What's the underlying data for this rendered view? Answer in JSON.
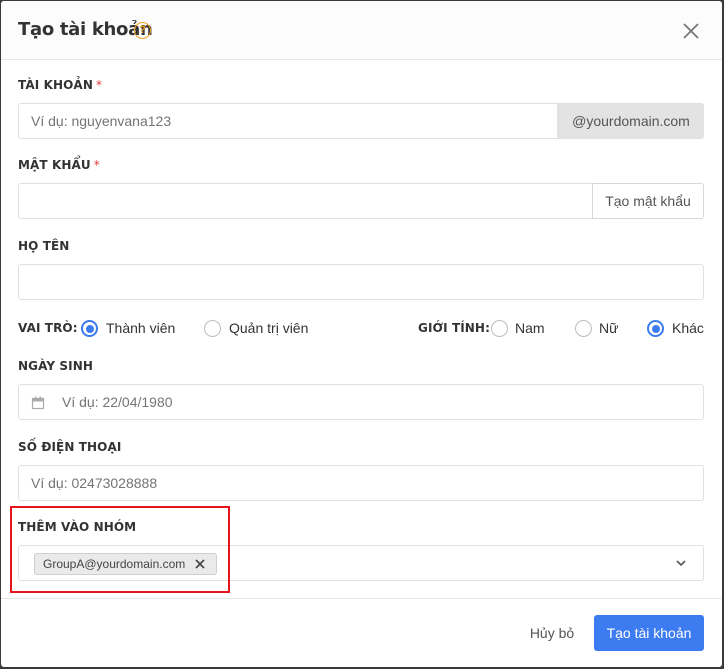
{
  "dialog": {
    "title": "Tạo tài khoản",
    "help_icon": "help-circle-icon",
    "close_icon": "close-icon"
  },
  "account": {
    "label": "TÀI KHOẢN",
    "required_mark": "*",
    "placeholder": "Ví dụ: nguyenvana123",
    "value": "",
    "domain_suffix": "@yourdomain.com"
  },
  "password": {
    "label": "MẬT KHẨU",
    "required_mark": "*",
    "value": "",
    "generate_button": "Tạo mật khẩu"
  },
  "fullname": {
    "label": "HỌ TÊN",
    "value": ""
  },
  "role": {
    "label": "VAI TRÒ:",
    "options": [
      {
        "label": "Thành viên",
        "selected": true
      },
      {
        "label": "Quản trị viên",
        "selected": false
      }
    ]
  },
  "gender": {
    "label": "GIỚI TÍNH:",
    "options": [
      {
        "label": "Nam",
        "selected": false
      },
      {
        "label": "Nữ",
        "selected": false
      },
      {
        "label": "Khác",
        "selected": true
      }
    ]
  },
  "birthday": {
    "label": "NGÀY SINH",
    "placeholder": "Ví dụ: 22/04/1980",
    "icon": "calendar-icon"
  },
  "phone": {
    "label": "SỐ ĐIỆN THOẠI",
    "placeholder": "Ví dụ: 02473028888"
  },
  "group": {
    "label": "THÊM VÀO NHÓM",
    "chips": [
      "GroupA@yourdomain.com"
    ],
    "dropdown_icon": "chevron-down-icon"
  },
  "footer": {
    "cancel": "Hủy bỏ",
    "submit": "Tạo tài khoản"
  },
  "colors": {
    "primary": "#3d7cf0",
    "required": "#e53935",
    "help": "#f0a020",
    "highlight": "#e3141b"
  }
}
